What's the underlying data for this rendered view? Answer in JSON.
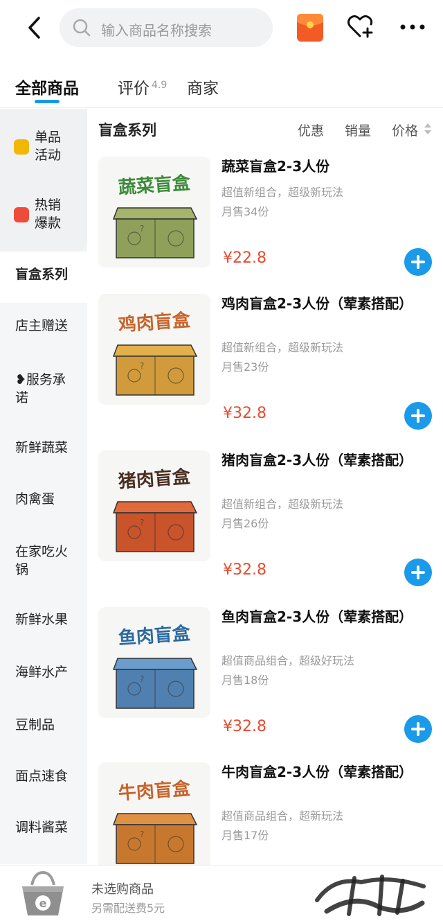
{
  "header": {
    "search_placeholder": "输入商品名称搜索"
  },
  "tabs": [
    {
      "label": "全部商品",
      "active": true
    },
    {
      "label": "评价",
      "rating": "4.9"
    },
    {
      "label": "商家"
    }
  ],
  "sidebar": {
    "items": [
      {
        "label": "单品\n活动",
        "badge_color": "#f2b705"
      },
      {
        "label": "热销\n爆款",
        "badge_color": "#ef4b3a"
      },
      {
        "label": "盲盒系列",
        "active": true
      },
      {
        "label": "店主赠送"
      },
      {
        "label": "❥服务承\n诺"
      },
      {
        "label": "新鲜蔬菜"
      },
      {
        "label": "肉禽蛋"
      },
      {
        "label": "在家吃火\n锅"
      },
      {
        "label": "新鲜水果"
      },
      {
        "label": "海鲜水产"
      },
      {
        "label": "豆制品"
      },
      {
        "label": "面点速食"
      },
      {
        "label": "调料酱菜"
      }
    ]
  },
  "section": {
    "title": "盲盒系列",
    "sort": [
      "优惠",
      "销量",
      "价格"
    ]
  },
  "products": [
    {
      "box_title": "蔬菜盲盒",
      "name": "蔬菜盲盒2-3人份",
      "desc": "超值新组合，超级新玩法",
      "sales": "月售34份",
      "price": "¥22.8",
      "box_color": "#8fa05a",
      "box_top": "#a4b46a",
      "title_color": "#3c8a3a"
    },
    {
      "box_title": "鸡肉盲盒",
      "name": "鸡肉盲盒2-3人份（荤素搭配）",
      "desc": "超值新组合，超级新玩法",
      "sales": "月售23份",
      "price": "¥32.8",
      "box_color": "#d19a3a",
      "box_top": "#e4b04c",
      "title_color": "#c8632a"
    },
    {
      "box_title": "猪肉盲盒",
      "name": "猪肉盲盒2-3人份（荤素搭配）",
      "desc": "超值新组合，超级新玩法",
      "sales": "月售26份",
      "price": "¥32.8",
      "box_color": "#c9532a",
      "box_top": "#e06a3c",
      "title_color": "#4a2e22"
    },
    {
      "box_title": "鱼肉盲盒",
      "name": "鱼肉盲盒2-3人份（荤素搭配）",
      "desc": "超值商品组合，超级好玩法",
      "sales": "月售18份",
      "price": "¥32.8",
      "box_color": "#4f80b0",
      "box_top": "#6a9ccc",
      "title_color": "#2c6aa0"
    },
    {
      "box_title": "牛肉盲盒",
      "name": "牛肉盲盒2-3人份（荤素搭配）",
      "desc": "超值商品组合，超新玩法",
      "sales": "月售17份",
      "price": "",
      "box_color": "#c8782e",
      "box_top": "#df9244",
      "title_color": "#c8632a"
    }
  ],
  "bottom": {
    "cart_empty": "未选购商品",
    "fee": "另需配送费5元"
  }
}
